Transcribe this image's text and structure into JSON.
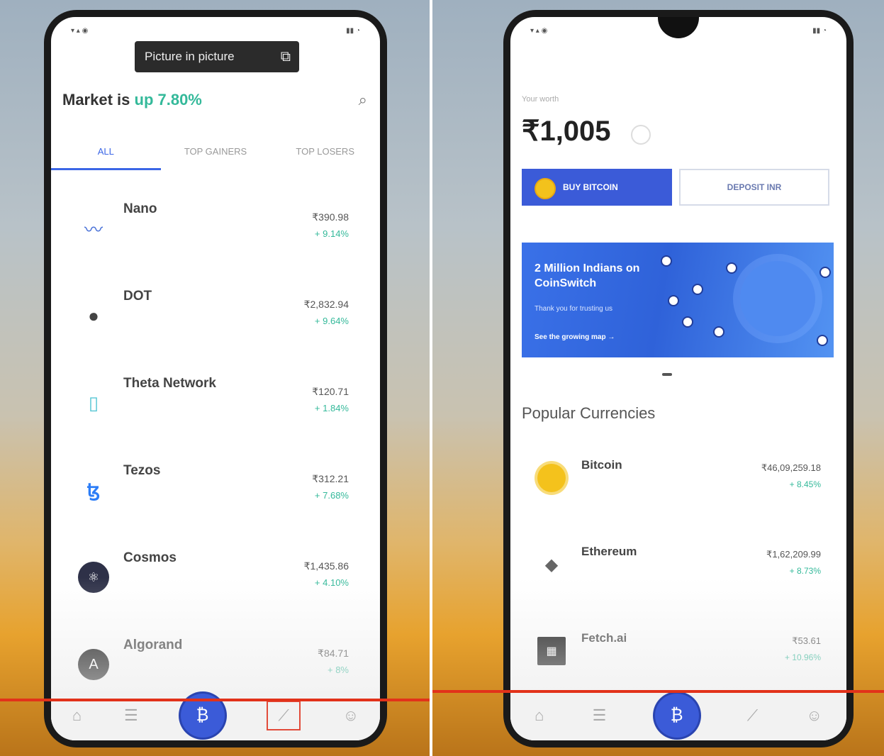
{
  "left_screen": {
    "pip_label": "Picture in picture",
    "market_prefix": "Market is ",
    "market_highlight": "up 7.80%",
    "market_suffix": "",
    "tabs": [
      {
        "label": "ALL"
      },
      {
        "label": "TOP GAINERS"
      },
      {
        "label": "TOP LOSERS"
      }
    ],
    "coins": [
      {
        "name": "Nano",
        "price": "₹390.98",
        "change": "+ 9.14%"
      },
      {
        "name": "DOT",
        "price": "₹2,832.94",
        "change": "+ 9.64%"
      },
      {
        "name": "Theta Network",
        "price": "₹120.71",
        "change": "+ 1.84%"
      },
      {
        "name": "Tezos",
        "price": "₹312.21",
        "change": "+ 7.68%"
      },
      {
        "name": "Cosmos",
        "price": "₹1,435.86",
        "change": "+ 4.10%"
      },
      {
        "name": "Algorand",
        "price": "₹84.71",
        "change": "+ 8%"
      }
    ]
  },
  "right_screen": {
    "balance_label": "Your worth",
    "balance": "₹1,005",
    "buy_label": "BUY BITCOIN",
    "deposit_label": "DEPOSIT INR",
    "banner": {
      "title": "2 Million Indians on CoinSwitch",
      "subtitle": "Thank you for trusting us",
      "link": "See the growing map →"
    },
    "section_title": "Popular Currencies",
    "popular": [
      {
        "name": "Bitcoin",
        "price": "₹46,09,259.18",
        "change": "+ 8.45%"
      },
      {
        "name": "Ethereum",
        "price": "₹1,62,209.99",
        "change": "+ 8.73%"
      },
      {
        "name": "Fetch.ai",
        "price": "₹53.61",
        "change": "+ 10.96%"
      }
    ]
  },
  "colors": {
    "accent": "#3b5bd8",
    "positive": "#34b99a",
    "highlight_red": "#e2321a"
  }
}
